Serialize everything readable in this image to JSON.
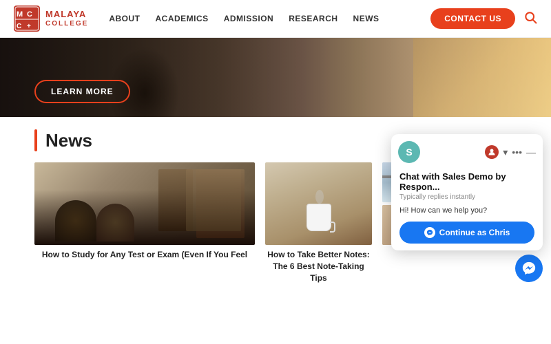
{
  "header": {
    "logo_name": "MALAYA",
    "logo_sub": "COLLEGE",
    "nav_items": [
      {
        "label": "ABOUT",
        "id": "about"
      },
      {
        "label": "ACADEMICS",
        "id": "academics"
      },
      {
        "label": "ADMISSION",
        "id": "admission"
      },
      {
        "label": "RESEARCH",
        "id": "research"
      },
      {
        "label": "NEWS",
        "id": "news"
      }
    ],
    "contact_label": "CONTACT US",
    "search_placeholder": "Search"
  },
  "hero": {
    "learn_more_label": "LEARN MORE"
  },
  "news": {
    "section_title": "News",
    "cards": [
      {
        "id": "card1",
        "title": "How to Study for Any Test or Exam (Even If You Feel"
      },
      {
        "id": "card2",
        "title": "How to Take Better Notes: The 6 Best Note-Taking Tips"
      },
      {
        "id": "card3",
        "title": ""
      }
    ]
  },
  "chat": {
    "avatar_letter": "S",
    "title": "Chat with Sales Demo by Respon...",
    "subtitle": "Typically replies instantly",
    "message": "Hi! How can we help you?",
    "continue_label": "Continue as Chris",
    "messenger_label": "Messenger"
  }
}
